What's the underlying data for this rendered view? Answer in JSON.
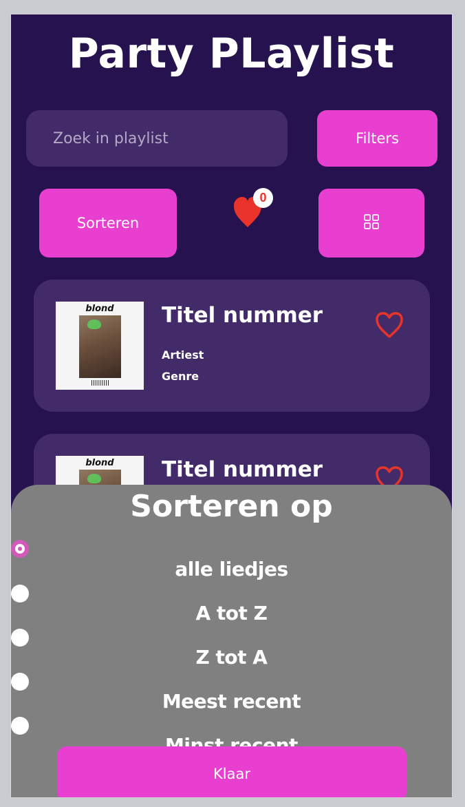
{
  "app": {
    "title": "Party PLaylist"
  },
  "search": {
    "placeholder": "Zoek in playlist"
  },
  "toolbar": {
    "filters_label": "Filters",
    "sort_label": "Sorteren",
    "favorites_count": "0",
    "view_icon": "grid-icon"
  },
  "tracks": [
    {
      "title": "Titel nummer",
      "artist": "Artiest",
      "genre": "Genre",
      "cover_text": "blond"
    },
    {
      "title": "Titel nummer",
      "cover_text": "blond"
    }
  ],
  "sort_sheet": {
    "title": "Sorteren op",
    "options": [
      {
        "label": "alle liedjes",
        "selected": true
      },
      {
        "label": "A tot Z",
        "selected": false
      },
      {
        "label": "Z tot A",
        "selected": false
      },
      {
        "label": "Meest recent",
        "selected": false
      },
      {
        "label": "Minst recent",
        "selected": false
      }
    ],
    "confirm_label": "Klaar"
  },
  "colors": {
    "background": "#25124f",
    "card": "#432a68",
    "accent": "#e83fd1",
    "heart": "#e8342a",
    "sheet": "#808080"
  }
}
